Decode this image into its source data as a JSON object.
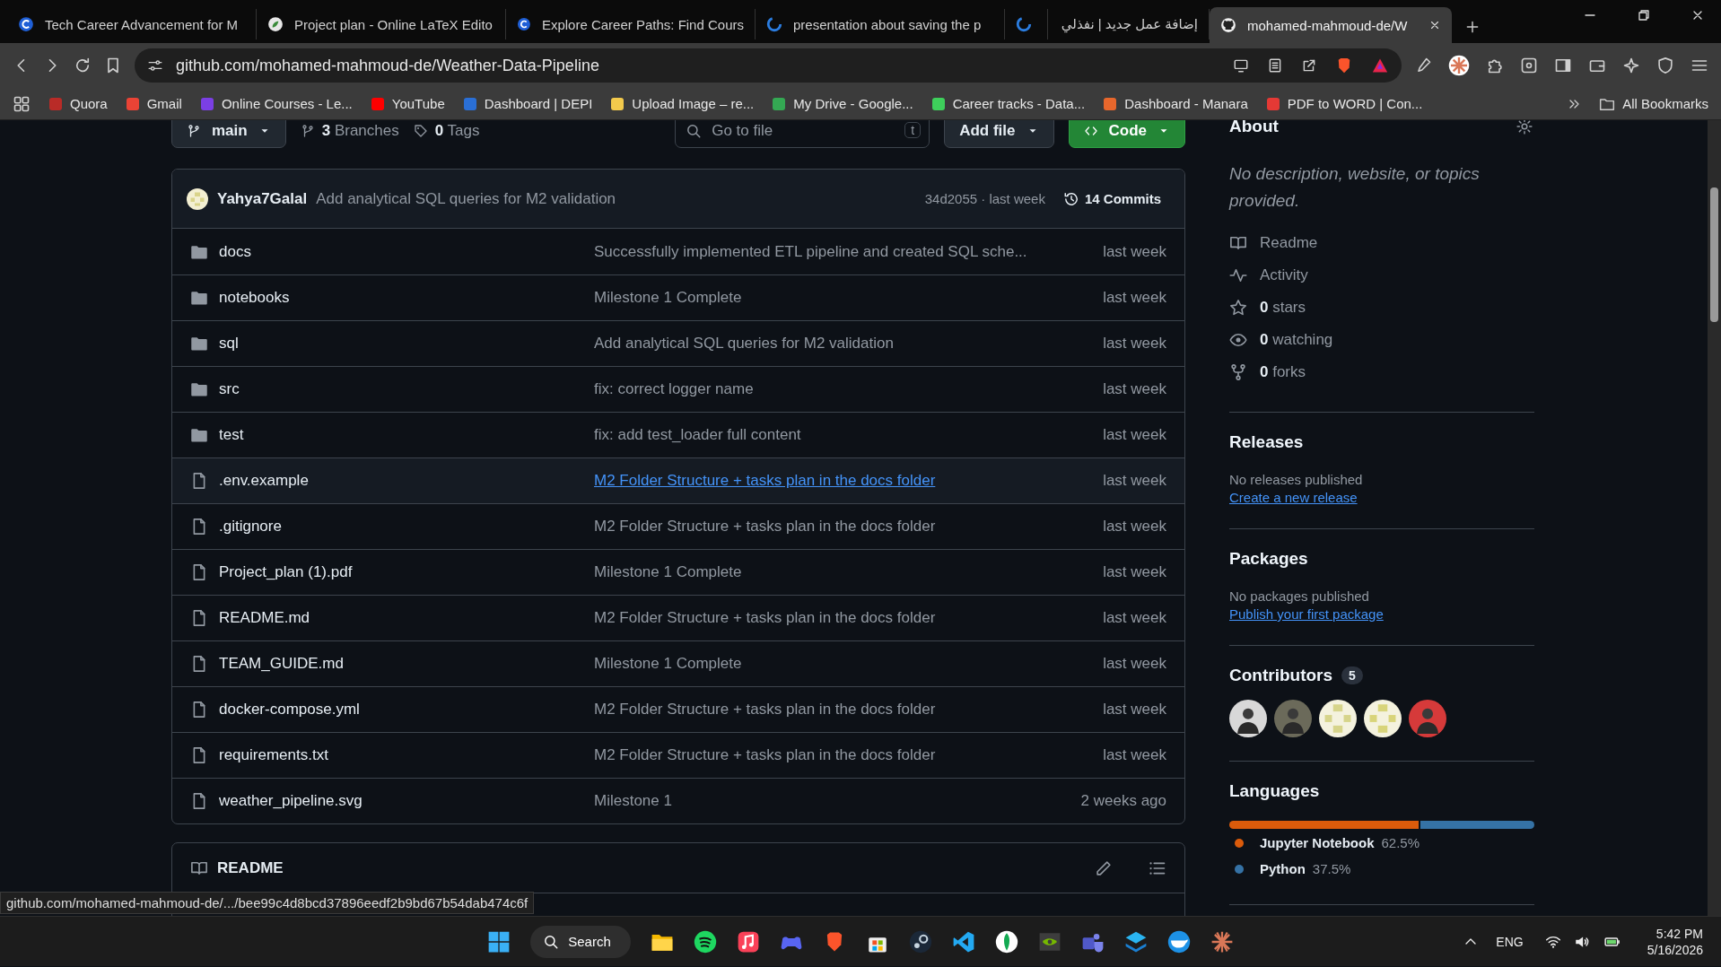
{
  "browser": {
    "tabs": [
      {
        "title": "Tech Career Advancement for M",
        "selected": false
      },
      {
        "title": "Project plan - Online LaTeX Edito",
        "selected": false
      },
      {
        "title": "Explore Career Paths: Find Cours",
        "selected": false
      },
      {
        "title": "presentation about saving the p",
        "selected": false
      },
      {
        "selected": false
      },
      {
        "title": "إضافة عمل جديد | نفذلي",
        "selected": false
      },
      {
        "title": "mohamed-mahmoud-de/W",
        "selected": true
      }
    ],
    "address": "github.com/mohamed-mahmoud-de/Weather-Data-Pipeline",
    "bookmarks": [
      "Quora",
      "Gmail",
      "Online Courses - Le...",
      "YouTube",
      "Dashboard | DEPI",
      "Upload Image – re...",
      "My Drive - Google...",
      "Career tracks - Data...",
      "Dashboard - Manara",
      "PDF to WORD | Con..."
    ],
    "all_bookmarks": "All Bookmarks"
  },
  "repo": {
    "branch": "main",
    "branches": "**3** Branches",
    "tags": "**0** Tags",
    "file_search": {
      "placeholder": "Go to file",
      "shortcut": "t"
    },
    "add_file": "Add file",
    "code": "Code"
  },
  "latest_commit": {
    "author": "Yahya7Galal",
    "message": "Add analytical SQL queries for M2 validation",
    "hash_time": "34d2055 · last week",
    "commits": "14 Commits"
  },
  "files": [
    {
      "kind": "folder",
      "name": "docs",
      "message": "Successfully implemented ETL pipeline and created SQL sche...",
      "time": "last week",
      "hovered": false
    },
    {
      "kind": "folder",
      "name": "notebooks",
      "message": "Milestone 1 Complete",
      "time": "last week",
      "hovered": false
    },
    {
      "kind": "folder",
      "name": "sql",
      "message": "Add analytical SQL queries for M2 validation",
      "time": "last week",
      "hovered": false
    },
    {
      "kind": "folder",
      "name": "src",
      "message": "fix: correct logger name",
      "time": "last week",
      "hovered": false
    },
    {
      "kind": "folder",
      "name": "test",
      "message": "fix: add test_loader full content",
      "time": "last week",
      "hovered": false
    },
    {
      "kind": "file",
      "name": ".env.example",
      "message": "M2 Folder Structure + tasks plan in the docs folder",
      "time": "last week",
      "hovered": true
    },
    {
      "kind": "file",
      "name": ".gitignore",
      "message": "M2 Folder Structure + tasks plan in the docs folder",
      "time": "last week",
      "hovered": false
    },
    {
      "kind": "file",
      "name": "Project_plan (1).pdf",
      "message": "Milestone 1 Complete",
      "time": "last week",
      "hovered": false
    },
    {
      "kind": "file",
      "name": "README.md",
      "message": "M2 Folder Structure + tasks plan in the docs folder",
      "time": "last week",
      "hovered": false
    },
    {
      "kind": "file",
      "name": "TEAM_GUIDE.md",
      "message": "Milestone 1 Complete",
      "time": "last week",
      "hovered": false
    },
    {
      "kind": "file",
      "name": "docker-compose.yml",
      "message": "M2 Folder Structure + tasks plan in the docs folder",
      "time": "last week",
      "hovered": false
    },
    {
      "kind": "file",
      "name": "requirements.txt",
      "message": "M2 Folder Structure + tasks plan in the docs folder",
      "time": "last week",
      "hovered": false
    },
    {
      "kind": "file",
      "name": "weather_pipeline.svg",
      "message": "Milestone 1",
      "time": "2 weeks ago",
      "hovered": false
    }
  ],
  "readme": {
    "title": "README"
  },
  "about": {
    "title": "About",
    "description": "No description, website, or topics provided.",
    "stats": [
      "Readme",
      "Activity",
      "**0** stars",
      "**0** watching",
      "**0** forks"
    ]
  },
  "releases": {
    "title": "Releases",
    "empty": "No releases published",
    "link": "Create a new release"
  },
  "packages": {
    "title": "Packages",
    "empty": "No packages published",
    "link": "Publish your first package"
  },
  "contributors": {
    "title": "Contributors",
    "count": "5",
    "avatars": [
      {
        "kind": "photo"
      },
      {
        "kind": "photo"
      },
      {
        "kind": "identicon"
      },
      {
        "kind": "identicon"
      },
      {
        "kind": "photo"
      }
    ]
  },
  "languages": {
    "title": "Languages",
    "items": [
      {
        "name": "Jupyter Notebook",
        "percent": "62.5%",
        "color": "#da5b0b"
      },
      {
        "name": "Python",
        "percent": "37.5%",
        "color": "#3572a5"
      }
    ]
  },
  "status_url": "github.com/mohamed-mahmoud-de/.../bee99c4d8bcd37896eedf2b9bd67b54dab474c6f",
  "taskbar": {
    "search": "Search",
    "language": "ENG",
    "time": "5:42 PM",
    "date": "5/16/2026"
  }
}
